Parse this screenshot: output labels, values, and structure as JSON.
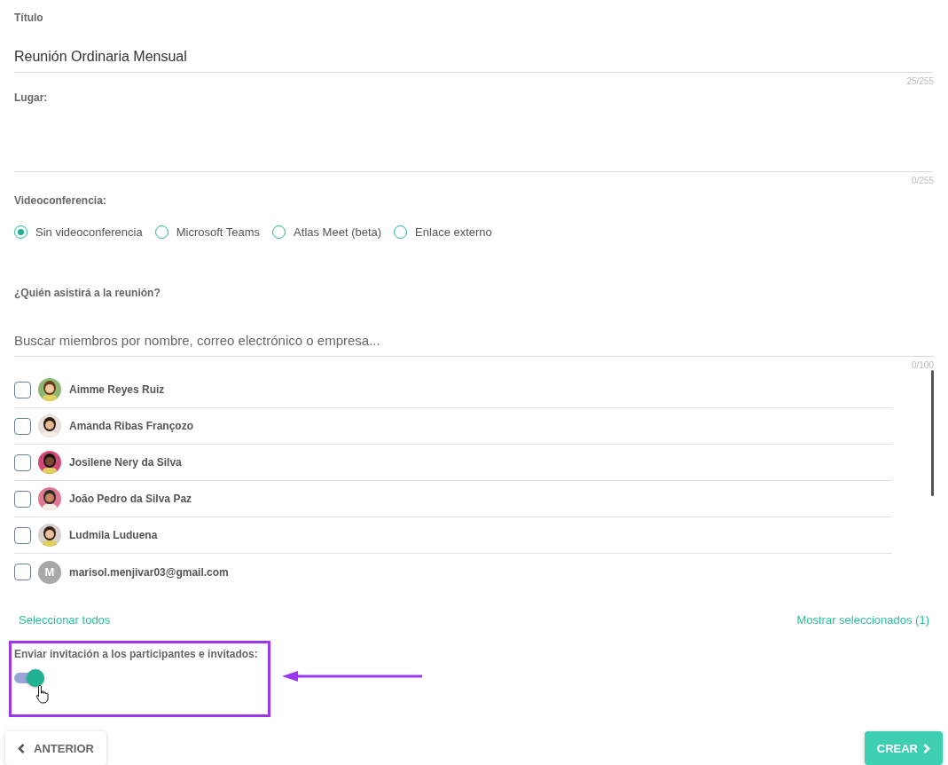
{
  "title_field": {
    "label": "Título",
    "value": "Reunión Ordinaria Mensual",
    "counter": "25/255"
  },
  "place_field": {
    "label": "Lugar:",
    "counter": "0/255"
  },
  "video": {
    "label": "Videoconferencia:",
    "options": [
      {
        "label": "Sin videoconferencia",
        "selected": true
      },
      {
        "label": "Microsoft Teams",
        "selected": false
      },
      {
        "label": "Atlas Meet (beta)",
        "selected": false
      },
      {
        "label": "Enlace externo",
        "selected": false
      }
    ]
  },
  "attendees": {
    "label": "¿Quién asistirá a la reunión?",
    "search": {
      "placeholder": "Buscar miembros por nombre, correo electrónico o empresa..."
    },
    "counter": "0/100",
    "members": [
      {
        "name": "Aimme Reyes Ruiz",
        "checked": false
      },
      {
        "name": "Amanda Ribas Françozo",
        "checked": false
      },
      {
        "name": "Josilene Nery da Silva",
        "checked": false
      },
      {
        "name": "João Pedro da Silva Paz",
        "checked": false
      },
      {
        "name": "Ludmila Luduena",
        "checked": false
      },
      {
        "name": "marisol.menjivar03@gmail.com",
        "checked": false,
        "kind": "initial",
        "initial": "M"
      }
    ],
    "select_all": "Seleccionar todos",
    "show_selected": "Mostrar seleccionados (1)"
  },
  "invite": {
    "label": "Enviar invitación a los participantes e invitados:",
    "on": true
  },
  "buttons": {
    "back": "ANTERIOR",
    "create": "CREAR"
  }
}
